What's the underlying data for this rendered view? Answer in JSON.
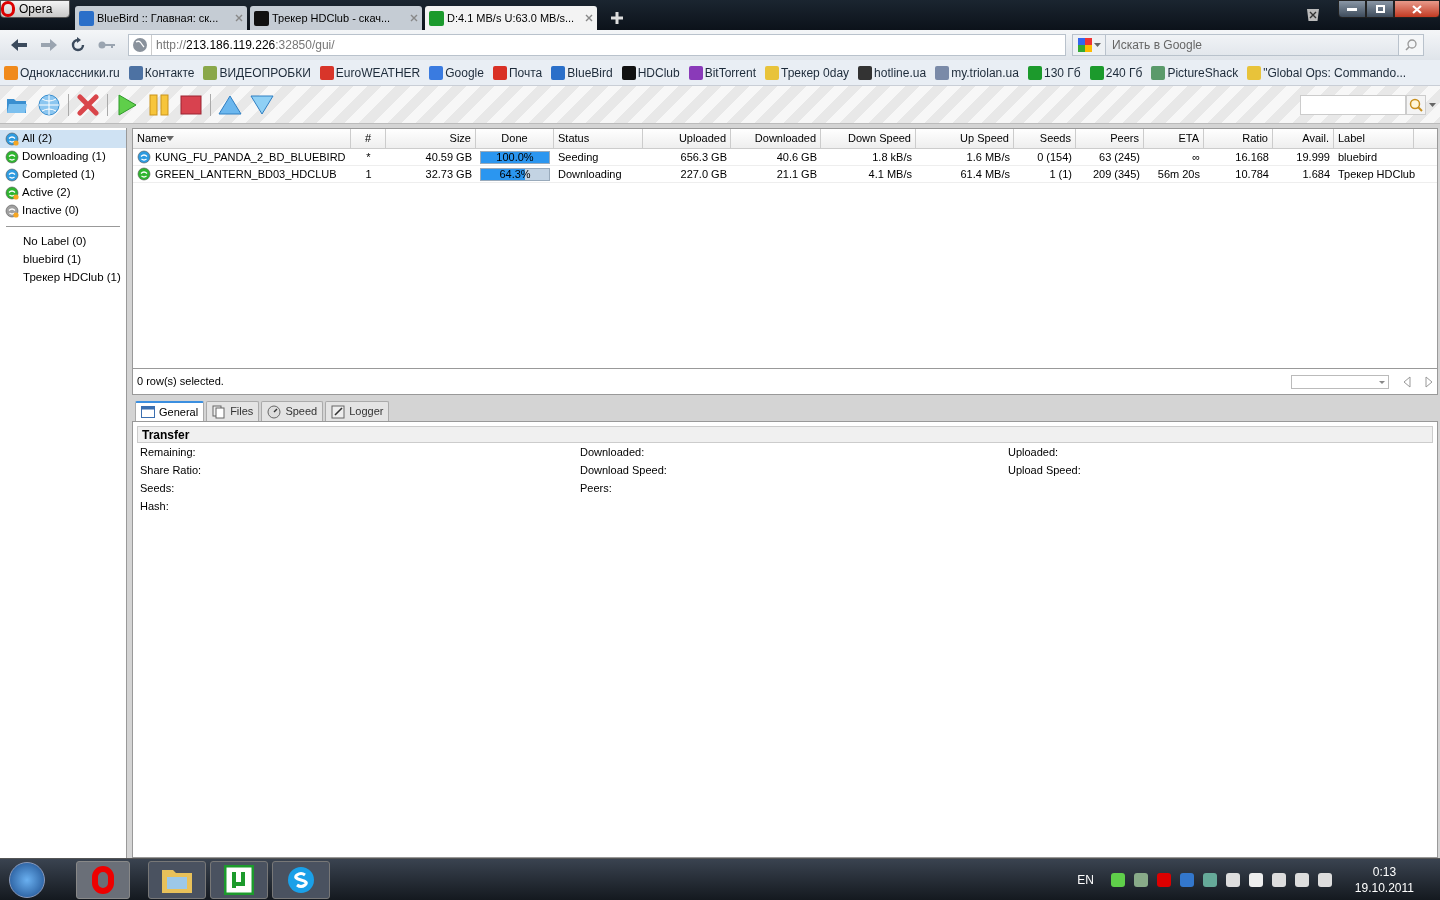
{
  "browser": {
    "menu_button": "Opera",
    "tabs": [
      {
        "title": "BlueBird :: Главная: ск...",
        "selected": false,
        "color": "#2a6fc9"
      },
      {
        "title": "Трекер HDClub - скач...",
        "selected": false,
        "color": "#111111"
      },
      {
        "title": "D:4.1 MB/s U:63.0 MB/s...",
        "selected": true,
        "color": "#1c9a2c"
      }
    ],
    "address": {
      "scheme": "http://",
      "host": "213.186.119.226",
      "path": ":32850/gui/"
    },
    "search": {
      "placeholder": "Искать в Google"
    },
    "bookmarks": [
      {
        "label": "Одноклассники.ru",
        "color": "#f08a1c"
      },
      {
        "label": "Контакте",
        "color": "#4d72a3"
      },
      {
        "label": "ВИДЕОПРОБКИ",
        "color": "#8aa84a"
      },
      {
        "label": "EuroWEATHER",
        "color": "#d8352a"
      },
      {
        "label": "Google",
        "color": "#3a7be0"
      },
      {
        "label": "Почта",
        "color": "#d93025"
      },
      {
        "label": "BlueBird",
        "color": "#2a6fc9"
      },
      {
        "label": "HDClub",
        "color": "#111111"
      },
      {
        "label": "BitTorrent",
        "color": "#8a3ab9"
      },
      {
        "label": "Трекер 0day",
        "color": "#e8c33a"
      },
      {
        "label": "hotline.ua",
        "color": "#333333"
      },
      {
        "label": "my.triolan.ua",
        "color": "#7a8aa8"
      },
      {
        "label": "130 Гб",
        "color": "#1c9a2c"
      },
      {
        "label": "240 Гб",
        "color": "#1c9a2c"
      },
      {
        "label": "PictureShack",
        "color": "#5a9a6a"
      },
      {
        "label": "\"Global Ops: Commando...",
        "color": "#e8c33a"
      }
    ]
  },
  "sidebar": {
    "categories": [
      {
        "label": "All (2)",
        "kind": "all",
        "selected": true
      },
      {
        "label": "Downloading (1)",
        "kind": "downloading",
        "selected": false
      },
      {
        "label": "Completed (1)",
        "kind": "completed",
        "selected": false
      },
      {
        "label": "Active (2)",
        "kind": "active",
        "selected": false
      },
      {
        "label": "Inactive (0)",
        "kind": "inactive",
        "selected": false
      }
    ],
    "labels": [
      {
        "label": "No Label (0)",
        "selected": false
      },
      {
        "label": "bluebird (1)",
        "selected": false
      },
      {
        "label": "Трекер HDClub (1)",
        "selected": false
      }
    ]
  },
  "table": {
    "columns": [
      "Name",
      "#",
      "Size",
      "Done",
      "Status",
      "Uploaded",
      "Downloaded",
      "Down Speed",
      "Up Speed",
      "Seeds",
      "Peers",
      "ETA",
      "Ratio",
      "Avail.",
      "Label"
    ],
    "rows": [
      {
        "kind": "seeding",
        "name": "KUNG_FU_PANDA_2_BD_BLUEBIRD",
        "queue": "*",
        "size": "40.59 GB",
        "done": "100.0%",
        "level": 1.0,
        "status": "Seeding",
        "uploaded": "656.3 GB",
        "downloaded": "40.6 GB",
        "down_speed": "1.8 kB/s",
        "up_speed": "1.6 MB/s",
        "seeds": "0 (154)",
        "peers": "63 (245)",
        "eta": "∞",
        "ratio": "16.168",
        "avail": "19.999",
        "label": "bluebird"
      },
      {
        "kind": "downloading",
        "name": "GREEN_LANTERN_BD03_HDCLUB",
        "queue": "1",
        "size": "32.73 GB",
        "done": "64.3%",
        "level": 0.643,
        "status": "Downloading",
        "uploaded": "227.0 GB",
        "downloaded": "21.1 GB",
        "down_speed": "4.1 MB/s",
        "up_speed": "61.4 MB/s",
        "seeds": "1 (1)",
        "peers": "209 (345)",
        "eta": "56m 20s",
        "ratio": "10.784",
        "avail": "1.684",
        "label": "Трекер HDClub"
      }
    ]
  },
  "status": "0 row(s) selected.",
  "detail_tabs": [
    {
      "label": "General",
      "kind": "general",
      "selected": true
    },
    {
      "label": "Files",
      "kind": "files",
      "selected": false
    },
    {
      "label": "Speed",
      "kind": "speed",
      "selected": false
    },
    {
      "label": "Logger",
      "kind": "logger",
      "selected": false
    }
  ],
  "transfer": {
    "title": "Transfer",
    "fields": [
      [
        "Remaining:",
        "Downloaded:",
        "Uploaded:"
      ],
      [
        "Share Ratio:",
        "Download Speed:",
        "Upload Speed:"
      ],
      [
        "Seeds:",
        "Peers:"
      ],
      [
        "Hash:"
      ]
    ]
  },
  "taskbar": {
    "language": "EN",
    "time": "0:13",
    "date": "19.10.2011"
  }
}
